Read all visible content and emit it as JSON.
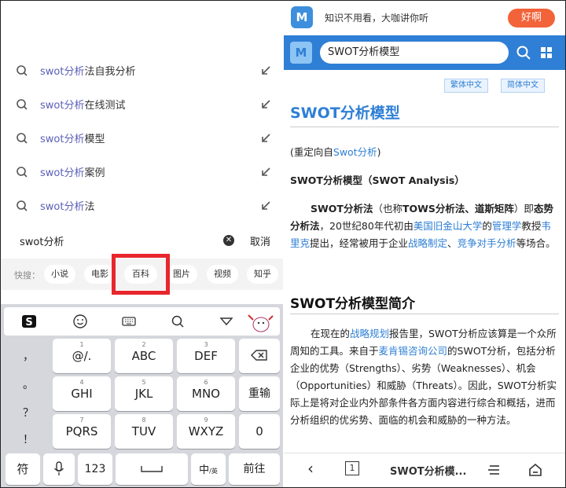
{
  "left": {
    "suggestions": [
      {
        "hl": "swot分析",
        "rest": "法自我分析"
      },
      {
        "hl": "swot分析",
        "rest": "在线测试"
      },
      {
        "hl": "swot分析",
        "rest": "模型"
      },
      {
        "hl": "swot分析",
        "rest": "案例"
      },
      {
        "hl": "swot分析",
        "rest": "法"
      }
    ],
    "query": "swot分析",
    "cancel": "取消",
    "quick_label": "快搜：",
    "chips": [
      "小说",
      "电影",
      "百科",
      "图片",
      "视频",
      "知乎"
    ],
    "keyboard": {
      "side": [
        "，",
        "。",
        "？",
        "！"
      ],
      "keys": [
        {
          "num": "1",
          "let": "@/."
        },
        {
          "num": "2",
          "let": "ABC"
        },
        {
          "num": "3",
          "let": "DEF"
        },
        {
          "num": "4",
          "let": "GHI"
        },
        {
          "num": "5",
          "let": "JKL"
        },
        {
          "num": "6",
          "let": "MNO"
        },
        {
          "num": "7",
          "let": "PQRS"
        },
        {
          "num": "8",
          "let": "TUV"
        },
        {
          "num": "9",
          "let": "WXYZ"
        }
      ],
      "reenter": "重输",
      "zero": "0",
      "sym": "符",
      "num123": "123",
      "lang": "中",
      "lang_sub": "/英",
      "go": "前往"
    }
  },
  "right": {
    "ad_text": "知识不用看，大咖讲你听",
    "ad_button": "好啊",
    "search_value": "SWOT分析模型",
    "lang_trad": "繁体中文",
    "lang_simp": "简体中文",
    "title": "SWOT分析模型",
    "redirect_pre": "(重定向自",
    "redirect_link": "Swot分析",
    "redirect_post": ")",
    "subtitle": "SWOT分析模型（SWOT Analysis）",
    "para1": {
      "b1": "SWOT分析法",
      "t1": "（也称",
      "b2": "TOWS分析法、道斯矩阵",
      "t2": "）即",
      "b3": "态势分析法",
      "t3": "，20世纪80年代初由",
      "l1": "美国旧金山大学",
      "t4": "的",
      "l2": "管理学",
      "t5": "教授",
      "l3": "韦里克",
      "t6": "提出，经常被用于企业",
      "l4": "战略制定",
      "t7": "、",
      "l5": "竞争对手分析",
      "t8": "等场合。"
    },
    "heading2": "SWOT分析模型简介",
    "para2": {
      "t1": "在现在的",
      "l1": "战略规划",
      "t2": "报告里，SWOT分析应该算是一个众所周知的工具。来自于",
      "l2": "麦肯锡咨询公司",
      "t3": "的SWOT分析，包括分析企业的优势（Strengths）、劣势（Weaknesses）、机会（Opportunities）和威胁（Threats）。因此，SWOT分析实际上是将对企业内外部条件各方面内容进行综合和概括，进而分析组织的优劣势、面临的机会和威胁的一种方法。"
    },
    "bottom": {
      "back": "‹",
      "tabs": "1",
      "title": "SWOT分析模..."
    }
  }
}
